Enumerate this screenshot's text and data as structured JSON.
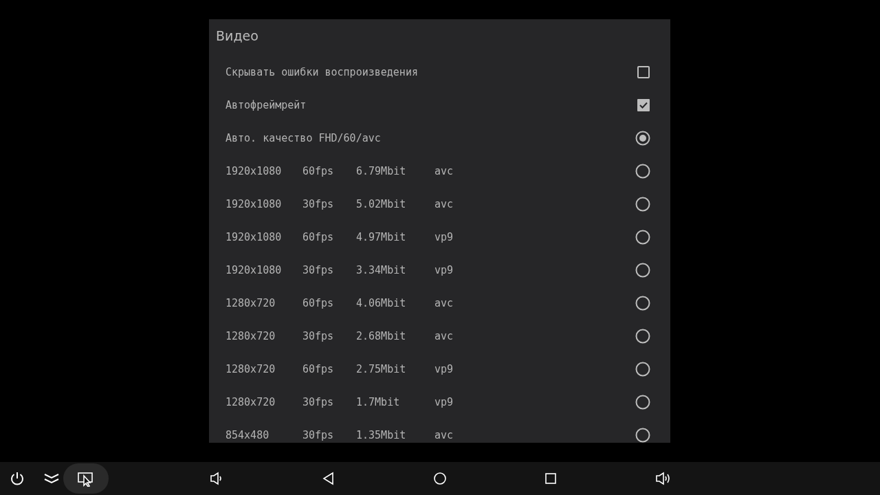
{
  "dialog": {
    "title": "Видео",
    "items": [
      {
        "kind": "checkbox",
        "label": "Скрывать ошибки воспроизведения",
        "checked": false
      },
      {
        "kind": "checkbox",
        "label": "Автофреймрейт",
        "checked": true
      },
      {
        "kind": "radio",
        "label": "Авто. качество FHD/60/avc",
        "selected": true
      },
      {
        "kind": "format",
        "resolution": "1920x1080",
        "fps": "60fps",
        "bitrate": "6.79Mbit",
        "codec": "avc",
        "selected": false
      },
      {
        "kind": "format",
        "resolution": "1920x1080",
        "fps": "30fps",
        "bitrate": "5.02Mbit",
        "codec": "avc",
        "selected": false
      },
      {
        "kind": "format",
        "resolution": "1920x1080",
        "fps": "60fps",
        "bitrate": "4.97Mbit",
        "codec": "vp9",
        "selected": false
      },
      {
        "kind": "format",
        "resolution": "1920x1080",
        "fps": "30fps",
        "bitrate": "3.34Mbit",
        "codec": "vp9",
        "selected": false
      },
      {
        "kind": "format",
        "resolution": "1280x720",
        "fps": "60fps",
        "bitrate": "4.06Mbit",
        "codec": "avc",
        "selected": false
      },
      {
        "kind": "format",
        "resolution": "1280x720",
        "fps": "30fps",
        "bitrate": "2.68Mbit",
        "codec": "avc",
        "selected": false
      },
      {
        "kind": "format",
        "resolution": "1280x720",
        "fps": "60fps",
        "bitrate": "2.75Mbit",
        "codec": "vp9",
        "selected": false
      },
      {
        "kind": "format",
        "resolution": "1280x720",
        "fps": "30fps",
        "bitrate": "1.7Mbit",
        "codec": "vp9",
        "selected": false
      },
      {
        "kind": "format",
        "resolution": "854x480",
        "fps": "30fps",
        "bitrate": "1.35Mbit",
        "codec": "avc",
        "selected": false
      }
    ]
  }
}
